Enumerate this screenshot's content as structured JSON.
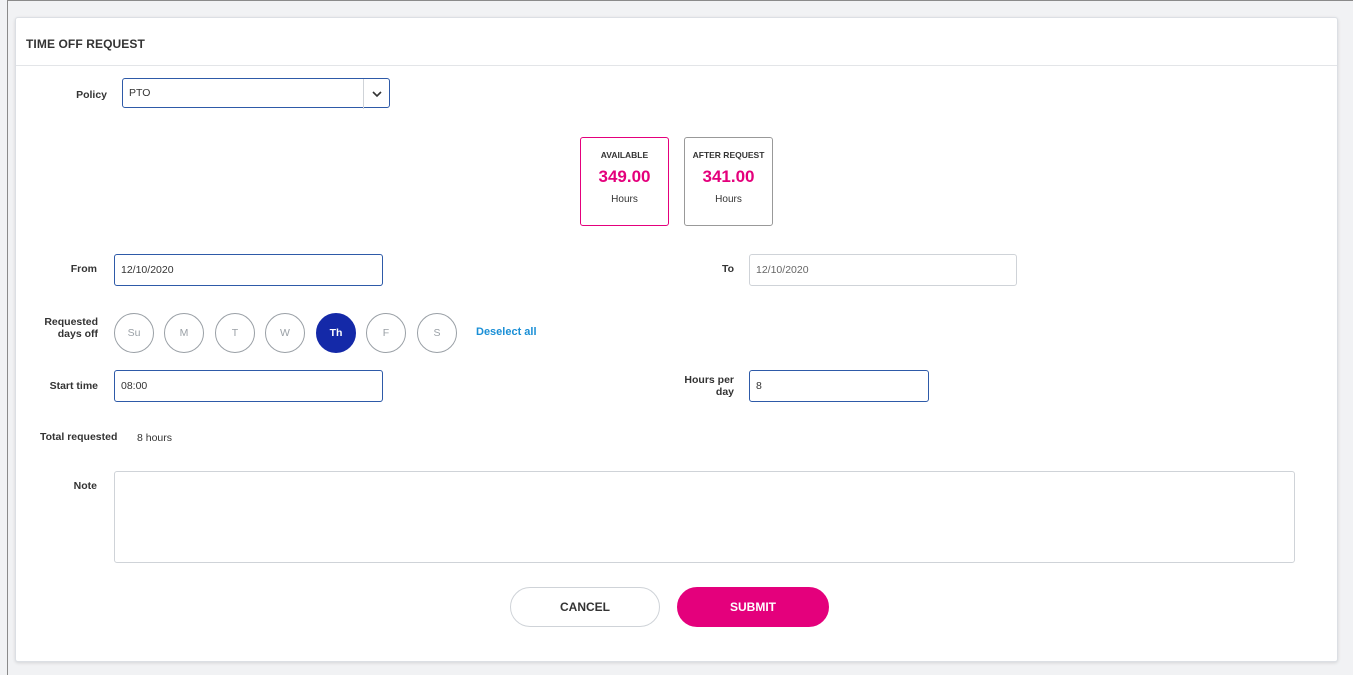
{
  "header": {
    "title": "TIME OFF REQUEST"
  },
  "policy": {
    "label": "Policy",
    "value": "PTO"
  },
  "balances": {
    "available": {
      "label": "AVAILABLE",
      "value": "349.00",
      "unit": "Hours"
    },
    "after_request": {
      "label": "AFTER REQUEST",
      "value": "341.00",
      "unit": "Hours"
    }
  },
  "dates": {
    "from_label": "From",
    "from_value": "12/10/2020",
    "to_label": "To",
    "to_value": "12/10/2020"
  },
  "days_off": {
    "label_line1": "Requested",
    "label_line2": "days off",
    "days": [
      {
        "label": "Su",
        "selected": false
      },
      {
        "label": "M",
        "selected": false
      },
      {
        "label": "T",
        "selected": false
      },
      {
        "label": "W",
        "selected": false
      },
      {
        "label": "Th",
        "selected": true
      },
      {
        "label": "F",
        "selected": false
      },
      {
        "label": "S",
        "selected": false
      }
    ],
    "deselect_label": "Deselect all"
  },
  "time": {
    "start_label": "Start time",
    "start_value": "08:00",
    "hours_label_line1": "Hours per",
    "hours_label_line2": "day",
    "hours_value": "8"
  },
  "total": {
    "label": "Total requested",
    "value": "8 hours"
  },
  "note": {
    "label": "Note",
    "value": ""
  },
  "actions": {
    "cancel_label": "CANCEL",
    "submit_label": "SUBMIT"
  },
  "colors": {
    "accent": "#e4007c",
    "selected_day": "#1429a8",
    "link": "#1a8fd6"
  }
}
